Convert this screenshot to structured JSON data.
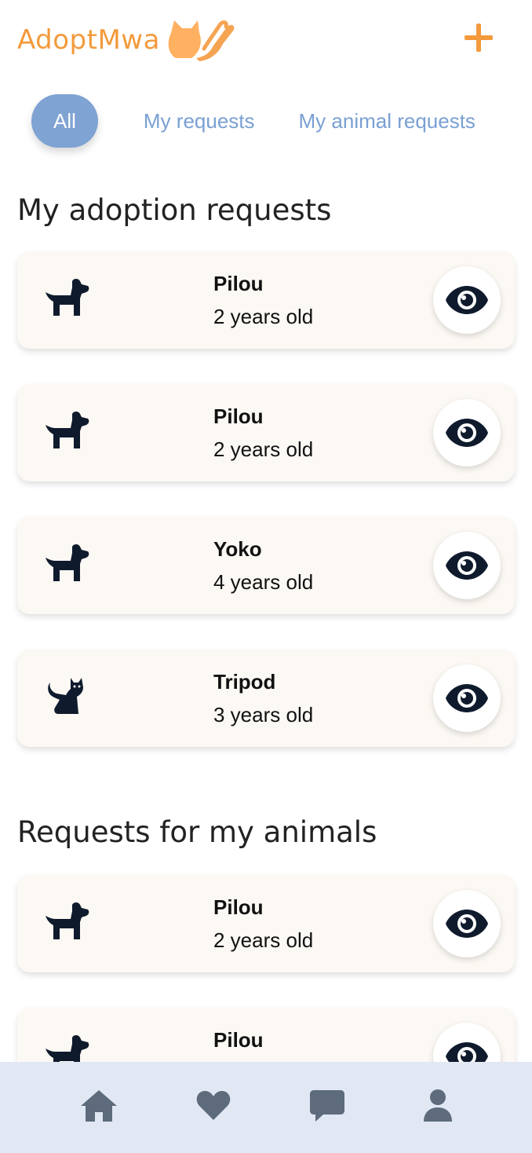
{
  "header": {
    "app_name": "AdoptMwa"
  },
  "tabs": [
    {
      "label": "All",
      "active": true
    },
    {
      "label": "My requests",
      "active": false
    },
    {
      "label": "My animal requests",
      "active": false
    }
  ],
  "sections": {
    "my_requests_title": "My adoption requests",
    "animal_requests_title": "Requests for my animals"
  },
  "my_requests": [
    {
      "name": "Pilou",
      "age": "2 years old",
      "animal": "dog-icon"
    },
    {
      "name": "Pilou",
      "age": "2 years old",
      "animal": "dog-icon"
    },
    {
      "name": "Yoko",
      "age": "4 years old",
      "animal": "dog-icon"
    },
    {
      "name": "Tripod",
      "age": "3 years old",
      "animal": "cat-icon"
    }
  ],
  "animal_requests": [
    {
      "name": "Pilou",
      "age": "2 years old",
      "animal": "dog-icon"
    },
    {
      "name": "Pilou",
      "age": "",
      "animal": "dog-icon"
    }
  ],
  "nav": {
    "items": [
      "home-icon",
      "heart-icon",
      "chat-icon",
      "user-icon"
    ]
  },
  "colors": {
    "brand_orange": "#f39a3c",
    "tab_blue": "#7fa3d3",
    "card_bg": "#fcf8f3",
    "nav_bg": "#e1e8f4",
    "icon_dark": "#0f1b2d"
  }
}
